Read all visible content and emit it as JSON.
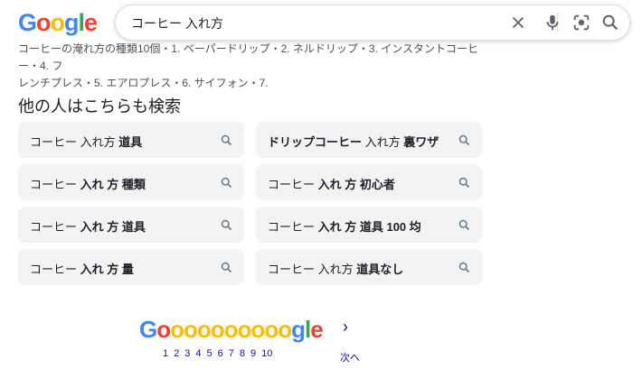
{
  "header": {
    "logo_letters": [
      "G",
      "o",
      "o",
      "g",
      "l",
      "e"
    ],
    "logo_colors": [
      "#4285F4",
      "#EA4335",
      "#FBBC05",
      "#4285F4",
      "#34A853",
      "#EA4335"
    ],
    "query": "コーヒー 入れ方"
  },
  "icons": {
    "clear": "close-icon",
    "voice": "microphone-icon",
    "lens": "camera-lens-icon",
    "search": "search-icon"
  },
  "snippet": {
    "line1": "コーヒーの淹れ方の種類10個・1. ペーパードリップ・2. ネルドリップ・3. インスタントコーヒー・4. フ",
    "line2": "レンチプレス・5. エアロプレス・6. サイフォン・7."
  },
  "related": {
    "title": "他の人はこちらも検索",
    "items": [
      {
        "plain": "コーヒー 入れ方 ",
        "bold": "道具"
      },
      {
        "plain": "",
        "bold": "ドリップコーヒー",
        "plain2": " 入れ方 ",
        "bold2": "裏ワザ"
      },
      {
        "plain": "コーヒー ",
        "bold": "入れ 方 種類"
      },
      {
        "plain": "コーヒー ",
        "bold": "入れ 方 初心者"
      },
      {
        "plain": "コーヒー ",
        "bold": "入れ 方 道具"
      },
      {
        "plain": "コーヒー ",
        "bold": "入れ 方 道具 100 均"
      },
      {
        "plain": "コーヒー ",
        "bold": "入れ 方 量"
      },
      {
        "plain": "コーヒー 入れ方 ",
        "bold": "道具なし"
      }
    ]
  },
  "pagination": {
    "logo": "Goooooooooogle",
    "pages": [
      "1",
      "2",
      "3",
      "4",
      "5",
      "6",
      "7",
      "8",
      "9",
      "10"
    ],
    "current": "1",
    "next_label": "次へ",
    "next_arrow": "›"
  },
  "colors": {
    "link": "#1a0dab",
    "chip_bg": "#f1f3f4"
  }
}
